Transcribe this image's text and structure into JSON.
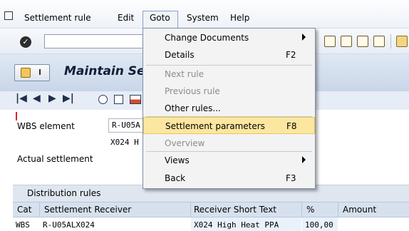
{
  "menubar": {
    "items": [
      "Settlement rule",
      "Edit",
      "Goto",
      "System",
      "Help"
    ]
  },
  "title": {
    "text": "Maintain Se"
  },
  "form": {
    "wbs_label": "WBS element",
    "wbs_value": "R-U05A",
    "wbs_desc": "X024 H",
    "actual_settlement_label": "Actual settlement"
  },
  "grid": {
    "title": "Distribution rules",
    "columns": [
      "Cat",
      "Settlement Receiver",
      "Receiver Short Text",
      "%",
      "Amount"
    ],
    "rows": [
      {
        "cat": "WBS",
        "receiver": "R-U05ALX024",
        "short_text": "X024 High Heat PPA",
        "percent": "100,00",
        "amount": ""
      }
    ]
  },
  "goto_menu": {
    "items": [
      {
        "label": "Change Documents",
        "shortcut": "",
        "submenu": true,
        "disabled": false
      },
      {
        "label": "Details",
        "shortcut": "F2",
        "submenu": false,
        "disabled": false
      },
      {
        "label": "Next rule",
        "shortcut": "",
        "submenu": false,
        "disabled": true
      },
      {
        "label": "Previous rule",
        "shortcut": "",
        "submenu": false,
        "disabled": true
      },
      {
        "label": "Other rules...",
        "shortcut": "",
        "submenu": false,
        "disabled": false
      },
      {
        "label": "Settlement parameters",
        "shortcut": "F8",
        "submenu": false,
        "disabled": false,
        "highlighted": true
      },
      {
        "label": "Overview",
        "shortcut": "",
        "submenu": false,
        "disabled": true
      },
      {
        "label": "Views",
        "shortcut": "",
        "submenu": true,
        "disabled": false
      },
      {
        "label": "Back",
        "shortcut": "F3",
        "submenu": false,
        "disabled": false
      }
    ]
  },
  "colors": {
    "highlight": "#fbe7a0",
    "header_band": "#dfe6ef"
  }
}
